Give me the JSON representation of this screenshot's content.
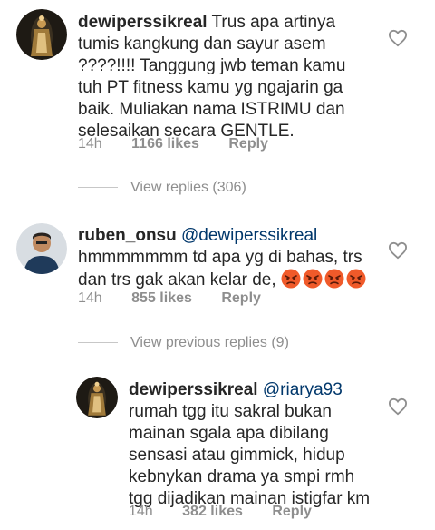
{
  "comments": [
    {
      "username": "dewiperssikreal",
      "text": "Trus apa artinya tumis kangkung dan sayur asem ????!!!! Tanggung jwb teman kamu tuh PT fitness kamu yg ngajarin ga baik. Muliakan nama ISTRIMU dan selesaikan secara GENTLE.",
      "time": "14h",
      "likes": "1166 likes",
      "reply_label": "Reply",
      "avatar": "avatar",
      "like_icon": "heart-outline"
    },
    {
      "username": "ruben_onsu",
      "mention": "@dewiperssikreal",
      "text": "hmmmmmmm td apa yg di bahas, trs dan trs gak akan kelar de,",
      "emojis": [
        "angry-face",
        "angry-face",
        "angry-face",
        "angry-face"
      ],
      "time": "14h",
      "likes": "855 likes",
      "reply_label": "Reply",
      "avatar": "avatar",
      "like_icon": "heart-outline"
    },
    {
      "username": "dewiperssikreal",
      "mention": "@riarya93",
      "text": "rumah tgg itu sakral bukan mainan sgala apa dibilang sensasi atau gimmick, hidup kebnykan drama ya smpi rmh tgg dijadikan mainan istigfar km",
      "time": "14h",
      "likes": "382 likes",
      "reply_label": "Reply",
      "avatar": "avatar",
      "like_icon": "heart-outline"
    }
  ],
  "view_replies": "View replies (306)",
  "view_previous_replies": "View previous replies (9)",
  "colors": {
    "text": "#262626",
    "secondary": "#8e8e8e",
    "mention": "#00376b",
    "divider": "#c7c7c7"
  }
}
